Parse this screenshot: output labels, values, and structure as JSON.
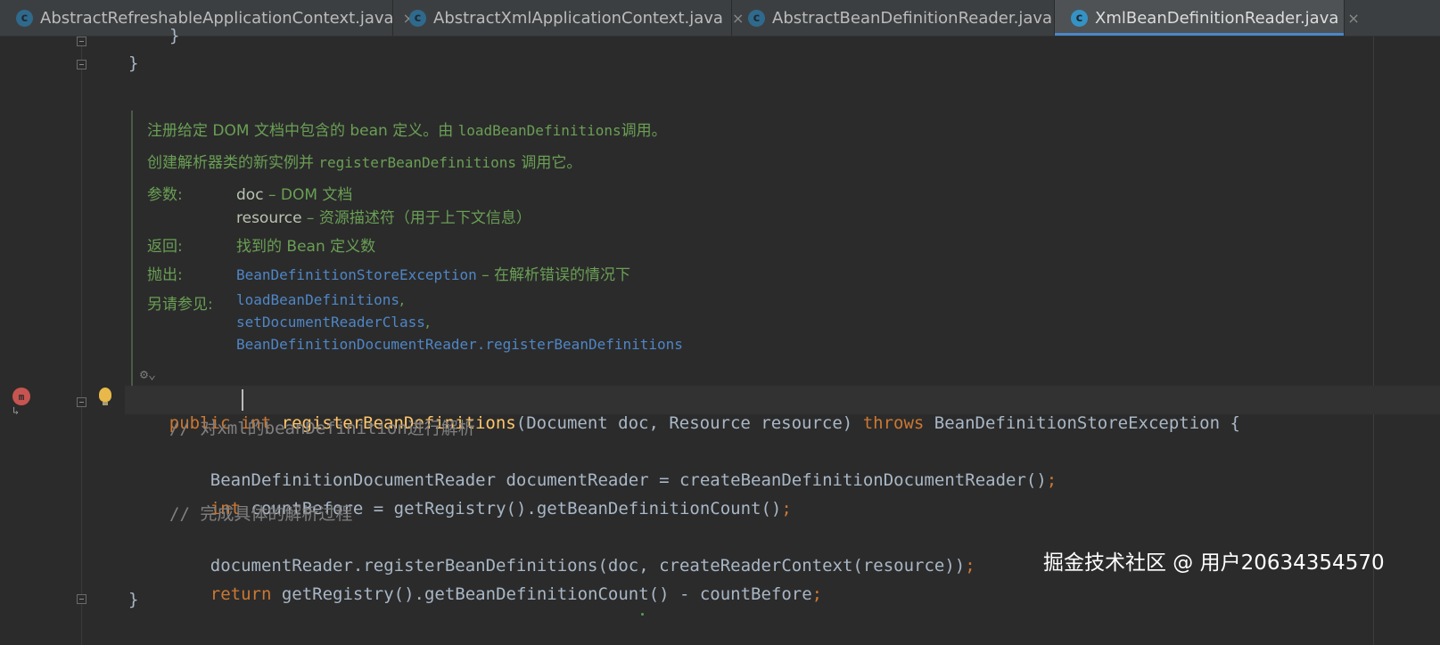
{
  "tabs": [
    {
      "label": "AbstractRefreshableApplicationContext.java",
      "icon": "class-icon",
      "close": "×",
      "active": false
    },
    {
      "label": "AbstractXmlApplicationContext.java",
      "icon": "class-icon",
      "close": "×",
      "active": false
    },
    {
      "label": "AbstractBeanDefinitionReader.java",
      "icon": "class-icon",
      "close": "×",
      "active": false
    },
    {
      "label": "XmlBeanDefinitionReader.java",
      "icon": "class-icon",
      "close": "×",
      "active": true
    }
  ],
  "tab_icon_glyph": "c",
  "code_top": {
    "line1": "}",
    "line2": "}"
  },
  "doc": {
    "line1_text": "注册给定 DOM 文档中包含的 bean 定义。由 ",
    "line1_code": "loadBeanDefinitions",
    "line1_tail": "调用。",
    "line2_text": "创建解析器类的新实例并 ",
    "line2_code": "registerBeanDefinitions",
    "line2_tail": " 调用它。",
    "params_label": "参数:",
    "param1_name": "doc",
    "param1_desc": " – DOM 文档",
    "param2_name": "resource",
    "param2_desc": " – 资源描述符（用于上下文信息）",
    "returns_label": "返回:",
    "returns_text": "找到的 Bean 定义数",
    "throws_label": "抛出:",
    "throws_link": "BeanDefinitionStoreException",
    "throws_desc": " – 在解析错误的情况下",
    "see_label": "另请参见:",
    "see1": "loadBeanDefinitions",
    "see2": "setDocumentReaderClass",
    "see3": "BeanDefinitionDocumentReader.registerBeanDefinitions",
    "comma": ","
  },
  "method": {
    "kw_public": "public",
    "kw_int": "int",
    "name": "registerBeanDefinitions",
    "params": "(Document doc, Resource resource) ",
    "kw_throws": "throws",
    "exception": " BeanDefinitionStoreException {"
  },
  "body": {
    "comment1": "// 对xml的beanDefinition进行解析",
    "line1": "BeanDefinitionDocumentReader documentReader = createBeanDefinitionDocumentReader()",
    "line2_kw": "int",
    "line2": " countBefore = getRegistry().getBeanDefinitionCount()",
    "comment2": "// 完成具体的解析过程",
    "line3": "documentReader.registerBeanDefinitions(doc, createReaderContext(resource))",
    "line4_kw": "return",
    "line4": " getRegistry().getBeanDefinitionCount() - countBefore",
    "semicolon": ";",
    "closing": "}"
  },
  "gutter": {
    "override_marker": "m",
    "gear_glyph": "⚙⌄"
  },
  "watermark": "掘金技术社区 @ 用户20634354570",
  "colors": {
    "keyword": "#cc7832",
    "method": "#ffc66d",
    "comment": "#808080",
    "doc": "#6a9f55",
    "link": "#4f86c6",
    "tab_accent": "#4a88c7"
  }
}
